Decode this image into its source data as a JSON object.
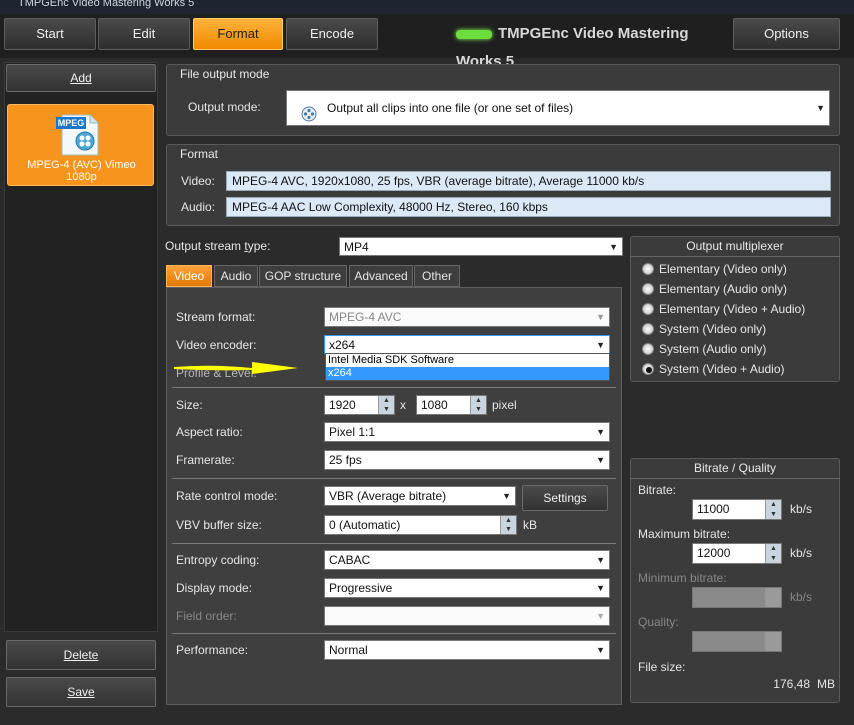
{
  "window": {
    "title": "TMPGEnc Video Mastering Works 5"
  },
  "nav": {
    "start": "Start",
    "edit": "Edit",
    "format": "Format",
    "encode": "Encode",
    "brand": "TMPGEnc Video Mastering Works 5",
    "options": "Options"
  },
  "left": {
    "add": "Add",
    "clip_badge": "MPEG",
    "clip_label": "MPEG-4 (AVC) Vimeo 1080p",
    "delete": "Delete",
    "save": "Save"
  },
  "file_output": {
    "header": "File output mode",
    "label": "Output mode:",
    "value": "Output all clips into one file (or one set of files)"
  },
  "format": {
    "header": "Format",
    "video_label": "Video:",
    "video_value": "MPEG-4 AVC, 1920x1080, 25 fps, VBR (average bitrate), Average 11000 kb/s",
    "audio_label": "Audio:",
    "audio_value": "MPEG-4 AAC Low Complexity, 48000 Hz, Stereo, 160 kbps"
  },
  "output_stream": {
    "label": "Output stream type:",
    "value": "MP4"
  },
  "tabs": [
    "Video",
    "Audio",
    "GOP structure",
    "Advanced",
    "Other"
  ],
  "video": {
    "stream_format_label": "Stream format:",
    "stream_format_value": "MPEG-4 AVC",
    "encoder_label": "Video encoder:",
    "encoder_value": "x264",
    "encoder_options": [
      "Intel Media SDK Software",
      "x264"
    ],
    "profile_label": "Profile & Level:",
    "size_label": "Size:",
    "width": "1920",
    "x": "x",
    "height": "1080",
    "pixel": "pixel",
    "aspect_label": "Aspect ratio:",
    "aspect_value": "Pixel 1:1",
    "framerate_label": "Framerate:",
    "framerate_value": "25 fps",
    "rate_label": "Rate control mode:",
    "rate_value": "VBR (Average bitrate)",
    "settings": "Settings",
    "vbv_label": "VBV buffer size:",
    "vbv_value": "0 (Automatic)",
    "kb": "kB",
    "entropy_label": "Entropy coding:",
    "entropy_value": "CABAC",
    "display_label": "Display mode:",
    "display_value": "Progressive",
    "field_label": "Field order:",
    "perf_label": "Performance:",
    "perf_value": "Normal"
  },
  "multiplexer": {
    "header": "Output multiplexer",
    "options": [
      "Elementary (Video only)",
      "Elementary (Audio only)",
      "Elementary (Video + Audio)",
      "System (Video only)",
      "System (Audio only)",
      "System (Video + Audio)"
    ],
    "selected_index": 5
  },
  "bitrate": {
    "header": "Bitrate / Quality",
    "bitrate_label": "Bitrate:",
    "bitrate_value": "11000",
    "max_label": "Maximum bitrate:",
    "max_value": "12000",
    "min_label": "Minimum bitrate:",
    "unit": "kb/s",
    "quality_label": "Quality:",
    "filesize_label": "File size:",
    "filesize_value": "176,48",
    "filesize_unit": "MB"
  },
  "colors": {
    "accent": "#f7941d",
    "highlight_arrow": "#ffff00",
    "selection": "#3399ff"
  }
}
